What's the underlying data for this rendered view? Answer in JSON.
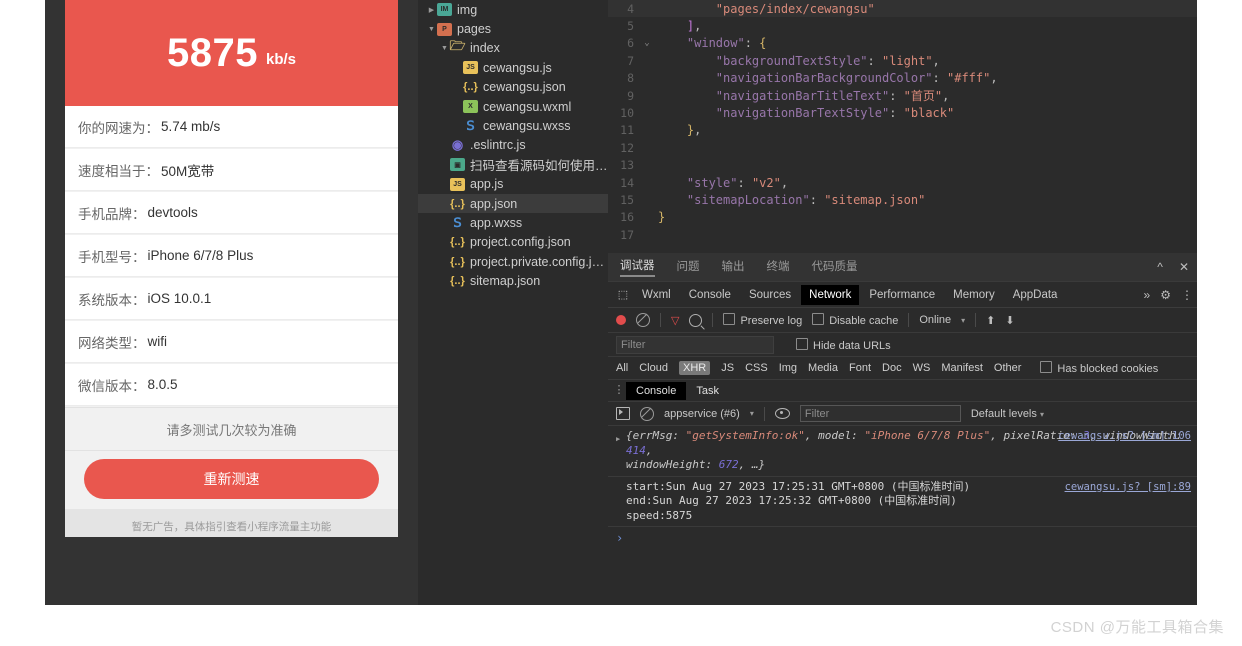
{
  "simulator": {
    "speed_value": "5875",
    "speed_unit": "kb/s",
    "rows": [
      {
        "label": "你的网速为：",
        "value": "5.74 mb/s"
      },
      {
        "label": "速度相当于：",
        "value": "50M宽带"
      },
      {
        "label": "手机品牌：",
        "value": "devtools"
      },
      {
        "label": "手机型号：",
        "value": "iPhone 6/7/8 Plus"
      },
      {
        "label": "系统版本：",
        "value": "iOS 10.0.1"
      },
      {
        "label": "网络类型：",
        "value": "wifi"
      },
      {
        "label": "微信版本：",
        "value": "8.0.5"
      }
    ],
    "note": "请多测试几次较为准确",
    "redo_button": "重新测速",
    "ad_note": "暂无广告，具体指引查看小程序流量主功能",
    "accent_color": "#e9574e"
  },
  "file_tree": [
    {
      "name": "img",
      "icon": "image-folder-icon",
      "indent": 0,
      "arrow": "▶",
      "selected": false
    },
    {
      "name": "pages",
      "icon": "pages-folder-icon",
      "indent": 0,
      "arrow": "▼",
      "selected": false
    },
    {
      "name": "index",
      "icon": "folder-icon",
      "indent": 1,
      "arrow": "▼",
      "selected": false
    },
    {
      "name": "cewangsu.js",
      "icon": "js-file-icon",
      "indent": 2,
      "arrow": "",
      "selected": false
    },
    {
      "name": "cewangsu.json",
      "icon": "json-file-icon",
      "indent": 2,
      "arrow": "",
      "selected": false
    },
    {
      "name": "cewangsu.wxml",
      "icon": "wxml-file-icon",
      "indent": 2,
      "arrow": "",
      "selected": false
    },
    {
      "name": "cewangsu.wxss",
      "icon": "wxss-file-icon",
      "indent": 2,
      "arrow": "",
      "selected": false
    },
    {
      "name": ".eslintrc.js",
      "icon": "eslint-file-icon",
      "indent": 1,
      "arrow": "",
      "selected": false
    },
    {
      "name": "扫码查看源码如何使用....",
      "icon": "scan-image-icon",
      "indent": 1,
      "arrow": "",
      "selected": false
    },
    {
      "name": "app.js",
      "icon": "js-file-icon",
      "indent": 1,
      "arrow": "",
      "selected": false
    },
    {
      "name": "app.json",
      "icon": "json-file-icon",
      "indent": 1,
      "arrow": "",
      "selected": true
    },
    {
      "name": "app.wxss",
      "icon": "wxss-file-icon",
      "indent": 1,
      "arrow": "",
      "selected": false
    },
    {
      "name": "project.config.json",
      "icon": "json-file-icon",
      "indent": 1,
      "arrow": "",
      "selected": false
    },
    {
      "name": "project.private.config.js...",
      "icon": "json-file-icon",
      "indent": 1,
      "arrow": "",
      "selected": false
    },
    {
      "name": "sitemap.json",
      "icon": "json-file-icon",
      "indent": 1,
      "arrow": "",
      "selected": false
    }
  ],
  "editor": {
    "lines": [
      {
        "num": "4",
        "fold": "",
        "highlight": true,
        "text": "        \"pages/index/cewangsu\""
      },
      {
        "num": "5",
        "fold": "",
        "highlight": false,
        "text": "    ],"
      },
      {
        "num": "6",
        "fold": "⌄",
        "highlight": false,
        "text": "    \"window\": {"
      },
      {
        "num": "7",
        "fold": "",
        "highlight": false,
        "text": "        \"backgroundTextStyle\": \"light\","
      },
      {
        "num": "8",
        "fold": "",
        "highlight": false,
        "text": "        \"navigationBarBackgroundColor\": \"#fff\","
      },
      {
        "num": "9",
        "fold": "",
        "highlight": false,
        "text": "        \"navigationBarTitleText\": \"首页\","
      },
      {
        "num": "10",
        "fold": "",
        "highlight": false,
        "text": "        \"navigationBarTextStyle\": \"black\""
      },
      {
        "num": "11",
        "fold": "",
        "highlight": false,
        "text": "    },"
      },
      {
        "num": "12",
        "fold": "",
        "highlight": false,
        "text": ""
      },
      {
        "num": "13",
        "fold": "",
        "highlight": false,
        "text": ""
      },
      {
        "num": "14",
        "fold": "",
        "highlight": false,
        "text": "    \"style\": \"v2\","
      },
      {
        "num": "15",
        "fold": "",
        "highlight": false,
        "text": "    \"sitemapLocation\": \"sitemap.json\""
      },
      {
        "num": "16",
        "fold": "",
        "highlight": false,
        "text": "}"
      },
      {
        "num": "17",
        "fold": "",
        "highlight": false,
        "text": ""
      }
    ]
  },
  "devtools": {
    "top_tabs": [
      {
        "label": "调试器",
        "active": true
      },
      {
        "label": "问题",
        "active": false
      },
      {
        "label": "输出",
        "active": false
      },
      {
        "label": "终端",
        "active": false
      },
      {
        "label": "代码质量",
        "active": false
      }
    ],
    "collapse_icon": "^",
    "close_icon": "✕",
    "panel_tabs": [
      {
        "label": "Wxml",
        "active": false
      },
      {
        "label": "Console",
        "active": false
      },
      {
        "label": "Sources",
        "active": false
      },
      {
        "label": "Network",
        "active": true
      },
      {
        "label": "Performance",
        "active": false
      },
      {
        "label": "Memory",
        "active": false
      },
      {
        "label": "AppData",
        "active": false
      }
    ],
    "more_tabs_icon": "»",
    "settings_icon": "gear-icon",
    "kebab_icon": "⋮",
    "network_toolbar": {
      "record_icon": "record-icon",
      "clear_icon": "clear-icon",
      "filter_icon": "funnel-icon",
      "search_icon": "search-icon",
      "preserve_log": "Preserve log",
      "disable_cache": "Disable cache",
      "throttling": "Online",
      "import_icon": "import-har-icon",
      "export_icon": "export-har-icon"
    },
    "filter_row": {
      "filter_placeholder": "Filter",
      "hide_data_urls": "Hide data URLs"
    },
    "resource_types": [
      "All",
      "Cloud",
      "XHR",
      "JS",
      "CSS",
      "Img",
      "Media",
      "Font",
      "Doc",
      "WS",
      "Manifest",
      "Other"
    ],
    "selected_resource_type": "XHR",
    "blocked_cookies": "Has blocked cookies",
    "drawer_tabs": [
      {
        "label": "Console",
        "active": true
      },
      {
        "label": "Task",
        "active": false
      }
    ],
    "console_toolbar": {
      "sidebar_icon": "console-sidebar-icon",
      "clear_icon": "clear-console-icon",
      "context": "appservice (#6)",
      "eye_icon": "live-expression-icon",
      "filter_placeholder": "Filter",
      "levels": "Default levels"
    },
    "console_messages": [
      {
        "source": "cewangsu.js? [sm]:106",
        "expandable": true,
        "segments": [
          {
            "t": "{errMsg: ",
            "c": "obj"
          },
          {
            "t": "\"getSystemInfo:ok\"",
            "c": "str"
          },
          {
            "t": ", model: ",
            "c": "obj"
          },
          {
            "t": "\"iPhone 6/7/8 Plus\"",
            "c": "str"
          },
          {
            "t": ", pixelRatio: ",
            "c": "obj"
          },
          {
            "t": "3",
            "c": "num"
          },
          {
            "t": ", windowWidth: ",
            "c": "obj"
          },
          {
            "t": "414",
            "c": "num"
          },
          {
            "t": ",",
            "c": "obj"
          }
        ],
        "second_line": [
          {
            "t": "windowHeight: ",
            "c": "obj"
          },
          {
            "t": "672",
            "c": "num"
          },
          {
            "t": ", …}",
            "c": "obj"
          }
        ]
      },
      {
        "source": "cewangsu.js? [sm]:89",
        "expandable": false,
        "plain_lines": [
          "start:Sun Aug 27 2023 17:25:31 GMT+0800 (中国标准时间)",
          "end:Sun Aug 27 2023 17:25:32 GMT+0800 (中国标准时间)",
          "speed:5875"
        ]
      }
    ],
    "prompt_icon": "›"
  },
  "watermark": "CSDN @万能工具箱合集"
}
